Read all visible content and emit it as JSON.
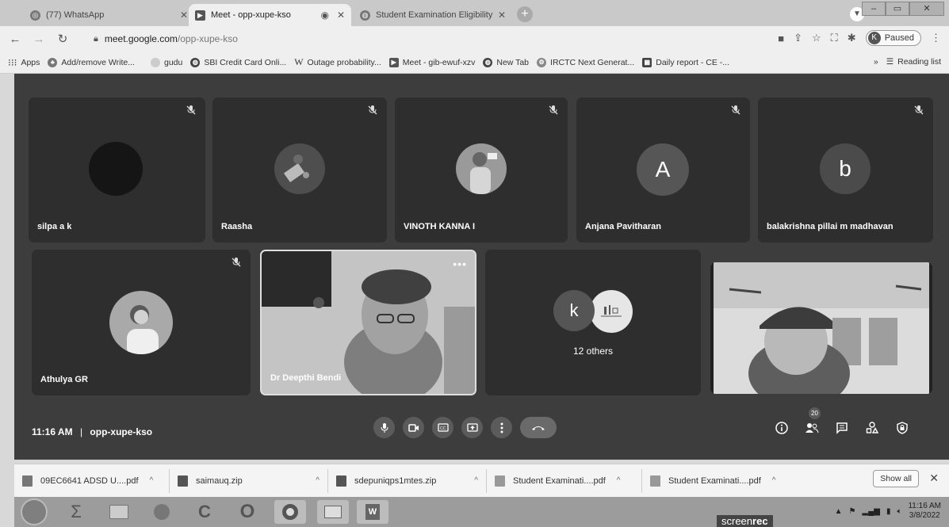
{
  "browser": {
    "tabs": [
      {
        "title": "(77) WhatsApp",
        "active": false,
        "icon": "whatsapp-icon"
      },
      {
        "title": "Meet - opp-xupe-kso",
        "active": true,
        "icon": "meet-icon"
      },
      {
        "title": "Student Examination Eligibility R",
        "active": false,
        "icon": "globe-icon"
      }
    ],
    "url_host": "meet.google.com",
    "url_path": "/opp-xupe-kso",
    "profile_letter": "K",
    "profile_status": "Paused"
  },
  "bookmarks": {
    "items": [
      {
        "label": "Apps",
        "icon": "apps-grid-icon"
      },
      {
        "label": "Add/remove Write...",
        "icon": "bookmark-icon"
      },
      {
        "label": "gudu",
        "icon": "bookmark-icon"
      },
      {
        "label": "SBI Credit Card Onli...",
        "icon": "globe-icon"
      },
      {
        "label": "Outage probability...",
        "icon": "wikipedia-icon"
      },
      {
        "label": "Meet - gib-ewuf-xzv",
        "icon": "meet-icon"
      },
      {
        "label": "New Tab",
        "icon": "globe-icon"
      },
      {
        "label": "IRCTC Next Generat...",
        "icon": "irctc-icon"
      },
      {
        "label": "Daily report - CE -...",
        "icon": "sheets-icon"
      }
    ],
    "overflow": "»",
    "reading_list": "Reading list"
  },
  "meeting": {
    "time": "11:16 AM",
    "separator": "|",
    "code": "opp-xupe-kso",
    "participants_count": "20",
    "tiles": [
      {
        "name": "silpa a k",
        "muted": true,
        "avatar_type": "dark-circle"
      },
      {
        "name": "Raasha",
        "muted": true,
        "avatar_type": "photo"
      },
      {
        "name": "VINOTH KANNA I",
        "muted": true,
        "avatar_type": "photo"
      },
      {
        "name": "Anjana Pavitharan",
        "muted": true,
        "avatar_type": "letter",
        "letter": "A"
      },
      {
        "name": "balakrishna pillai m madhavan",
        "muted": true,
        "avatar_type": "letter",
        "letter": "b"
      },
      {
        "name": "Athulya GR",
        "muted": true,
        "avatar_type": "photo"
      },
      {
        "name": "Dr Deepthi Bendi",
        "muted": false,
        "avatar_type": "video"
      },
      {
        "name": "12 others",
        "muted": false,
        "avatar_type": "group",
        "letter": "k"
      },
      {
        "name": "",
        "muted": false,
        "avatar_type": "video"
      }
    ]
  },
  "downloads": {
    "items": [
      {
        "name": "09EC6641 ADSD U....pdf"
      },
      {
        "name": "saimauq.zip"
      },
      {
        "name": "sdepuniqps1mtes.zip"
      },
      {
        "name": "Student Examinati....pdf"
      },
      {
        "name": "Student Examinati....pdf"
      }
    ],
    "show_all": "Show all",
    "close": "✕"
  },
  "taskbar": {
    "recorder_label_a": "screen",
    "recorder_label_b": "rec",
    "clock_time": "11:16 AM",
    "clock_date": "3/8/2022"
  }
}
